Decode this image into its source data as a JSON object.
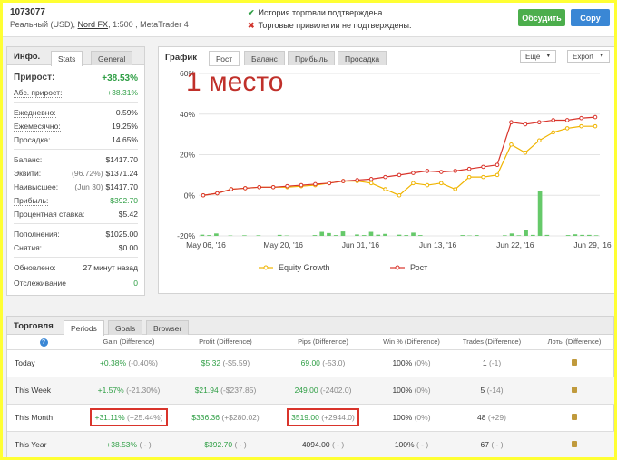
{
  "header": {
    "account_id": "1073077",
    "account_type": "Реальный (USD),",
    "broker": "Nord FX",
    "account_rest": ", 1:500 , MetaTrader 4",
    "verify_history": "История торговли подтверждена",
    "verify_privileges": "Торговые привилегии не подтверждены.",
    "discuss_label": "Обсудить",
    "copy_label": "Copy",
    "colors": {
      "discuss": "#4cae4c",
      "copy": "#3a87d5",
      "verified": "#2e9e44",
      "not_verified": "#d0342c"
    }
  },
  "info": {
    "title": "Инфо.",
    "tabs": [
      "Stats",
      "General"
    ],
    "gain_label": "Прирост:",
    "gain_value": "+38.53%",
    "abs_gain_label": "Абс. прирост:",
    "abs_gain_value": "+38.31%",
    "daily_label": "Ежедневно:",
    "daily_value": "0.59%",
    "monthly_label": "Ежемесячно:",
    "monthly_value": "19.25%",
    "drawdown_label": "Просадка:",
    "drawdown_value": "14.65%",
    "balance_label": "Баланс:",
    "balance_value": "$1417.70",
    "equity_label": "Эквити:",
    "equity_pct": "(96.72%)",
    "equity_value": "$1371.24",
    "highest_label": "Наивысшее:",
    "highest_date": "(Jun 30)",
    "highest_value": "$1417.70",
    "profit_label": "Прибыль:",
    "profit_value": "$392.70",
    "interest_label": "Процентная ставка:",
    "interest_value": "$5.42",
    "deposits_label": "Пополнения:",
    "deposits_value": "$1025.00",
    "withdrawals_label": "Снятия:",
    "withdrawals_value": "$0.00",
    "updated_label": "Обновлено:",
    "updated_value": "27 минут назад",
    "tracking_label": "Отслеживание",
    "tracking_value": "0"
  },
  "chart_panel": {
    "title": "График",
    "tabs": [
      "Рост",
      "Баланс",
      "Прибыль",
      "Просадка"
    ],
    "more_label": "Ещё",
    "export_label": "Export",
    "overlay_text": "1 место"
  },
  "chart_data": {
    "type": "line",
    "y_ticks": [
      "60%",
      "40%",
      "20%",
      "0%",
      "-20%"
    ],
    "ylim": [
      -20,
      60
    ],
    "x_ticks": [
      "May 06, '16",
      "May 20, '16",
      "Jun 01, '16",
      "Jun 13, '16",
      "Jun 22, '16",
      "Jun 29, '16"
    ],
    "series": [
      {
        "name": "Equity Growth",
        "color": "#f0b400",
        "values": [
          0,
          1,
          3,
          3.5,
          4,
          4,
          4,
          4.5,
          5,
          6,
          7,
          7,
          6,
          3,
          0,
          6,
          5,
          6,
          3,
          9,
          9,
          10,
          25,
          21,
          27,
          31,
          33,
          34,
          34
        ]
      },
      {
        "name": "Рост",
        "color": "#d9342b",
        "values": [
          0,
          1,
          3,
          3.5,
          4,
          4,
          4.5,
          5,
          5.5,
          6,
          7,
          7.5,
          8,
          9,
          10,
          11,
          12,
          11.5,
          12,
          13,
          14,
          15,
          36,
          35,
          36,
          37,
          37,
          38,
          38.5
        ]
      }
    ],
    "bars": {
      "color": "#66c96a",
      "values": [
        0.6,
        0.4,
        1.2,
        0,
        0.2,
        0,
        0.3,
        0,
        0.3,
        0,
        0,
        0.5,
        0.2,
        0,
        0,
        0,
        0.4,
        2,
        1.4,
        0.4,
        2.2,
        0,
        0.7,
        0.4,
        2,
        0.6,
        1,
        0,
        0.6,
        0.4,
        1.6,
        0.4,
        0,
        0,
        0,
        0,
        0,
        0.4,
        0.2,
        0.4,
        0,
        0,
        0,
        0.3,
        1.2,
        0.3,
        3,
        0.5,
        22,
        0.5,
        0,
        0,
        0.4,
        0.8,
        0.5,
        0.5,
        0.3
      ]
    },
    "legend": "bottom"
  },
  "trading": {
    "title": "Торговля",
    "tabs": [
      "Periods",
      "Goals",
      "Browser"
    ],
    "columns": [
      "?",
      "Gain (Difference)",
      "Profit (Difference)",
      "Pips (Difference)",
      "Win % (Difference)",
      "Trades (Difference)",
      "Лоты (Difference)"
    ],
    "rows": [
      {
        "label": "Today",
        "gain": "+0.38%",
        "gain_diff": "(-0.40%)",
        "profit": "$5.32",
        "profit_diff": "(-$5.59)",
        "pips": "69.00",
        "pips_diff": "(-53.0)",
        "win": "100%",
        "win_diff": "(0%)",
        "trades": "1",
        "trades_diff": "(-1)"
      },
      {
        "label": "This Week",
        "gain": "+1.57%",
        "gain_diff": "(-21.30%)",
        "profit": "$21.94",
        "profit_diff": "(-$237.85)",
        "pips": "249.00",
        "pips_diff": "(-2402.0)",
        "win": "100%",
        "win_diff": "(0%)",
        "trades": "5",
        "trades_diff": "(-14)"
      },
      {
        "label": "This Month",
        "gain": "+31.11%",
        "gain_diff": "(+25.44%)",
        "profit": "$336.36",
        "profit_diff": "(+$280.02)",
        "pips": "3519.00",
        "pips_diff": "(+2944.0)",
        "win": "100%",
        "win_diff": "(0%)",
        "trades": "48",
        "trades_diff": "(+29)"
      },
      {
        "label": "This Year",
        "gain": "+38.53%",
        "gain_diff": "( - )",
        "profit": "$392.70",
        "profit_diff": "( - )",
        "pips": "4094.00",
        "pips_diff": "( - )",
        "win": "100%",
        "win_diff": "( - )",
        "trades": "67",
        "trades_diff": "( - )"
      }
    ]
  }
}
